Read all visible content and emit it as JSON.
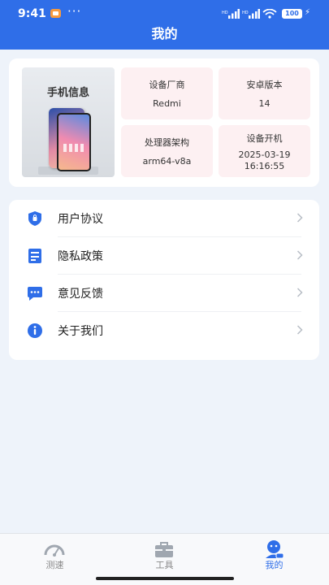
{
  "status_bar": {
    "time": "9:41",
    "dots": "···",
    "battery": "100"
  },
  "header": {
    "title": "我的"
  },
  "device_card": {
    "image_title": "手机信息",
    "cells": [
      {
        "label": "设备厂商",
        "value": "Redmi"
      },
      {
        "label": "安卓版本",
        "value": "14"
      },
      {
        "label": "处理器架构",
        "value": "arm64-v8a"
      },
      {
        "label": "设备开机",
        "value": "2025-03-19\n16:16:55"
      }
    ]
  },
  "menu": {
    "items": [
      {
        "label": "用户协议",
        "icon": "shield-icon"
      },
      {
        "label": "隐私政策",
        "icon": "document-icon"
      },
      {
        "label": "意见反馈",
        "icon": "chat-icon"
      },
      {
        "label": "关于我们",
        "icon": "info-icon"
      }
    ]
  },
  "tabbar": {
    "tabs": [
      {
        "label": "测速",
        "icon": "speedometer-icon",
        "active": false
      },
      {
        "label": "工具",
        "icon": "toolbox-icon",
        "active": false
      },
      {
        "label": "我的",
        "icon": "user-icon",
        "active": true
      }
    ]
  },
  "colors": {
    "primary": "#2f6ee8",
    "cell_bg": "#fdf0f2",
    "page_bg": "#eef3fa"
  }
}
